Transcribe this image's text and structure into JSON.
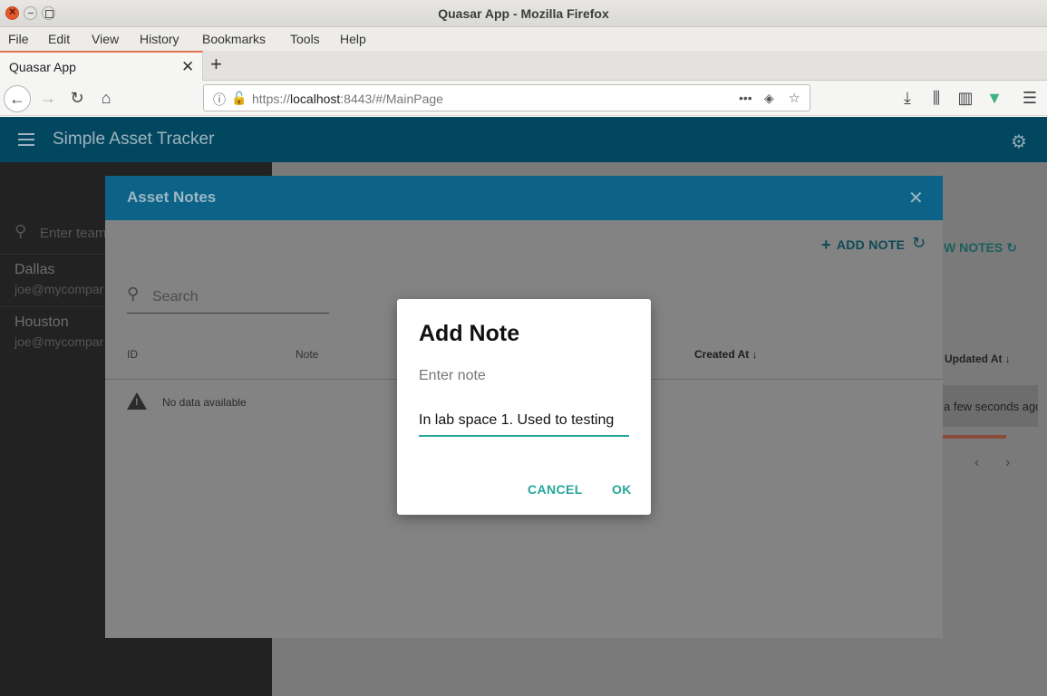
{
  "browser": {
    "window_title": "Quasar App - Mozilla Firefox",
    "menu": [
      "File",
      "Edit",
      "View",
      "History",
      "Bookmarks",
      "Tools",
      "Help"
    ],
    "tab_title": "Quasar App",
    "url_prefix": "https://",
    "url_host": "localhost",
    "url_rest": ":8443/#/MainPage"
  },
  "app": {
    "title": "Simple Asset Tracker",
    "drawer": {
      "search_placeholder": "Enter team",
      "teams": [
        {
          "name": "Dallas",
          "email": "joe@mycompar"
        },
        {
          "name": "Houston",
          "email": "joe@mycompar"
        }
      ]
    },
    "background": {
      "notes_button": "W NOTES",
      "updated_header": "Updated At",
      "row_updated": "a few seconds ago"
    }
  },
  "asset_notes": {
    "title": "Asset Notes",
    "add_note_label": "ADD NOTE",
    "search_placeholder": "Search",
    "columns": {
      "id": "ID",
      "note": "Note",
      "created": "Created At"
    },
    "no_data": "No data available"
  },
  "add_note_dialog": {
    "title": "Add Note",
    "label": "Enter note",
    "value": "In lab space 1. Used to testing",
    "cancel": "CANCEL",
    "ok": "OK"
  },
  "colors": {
    "header": "#02475f",
    "modal_header": "#0c6387",
    "accent": "#26a69a"
  }
}
